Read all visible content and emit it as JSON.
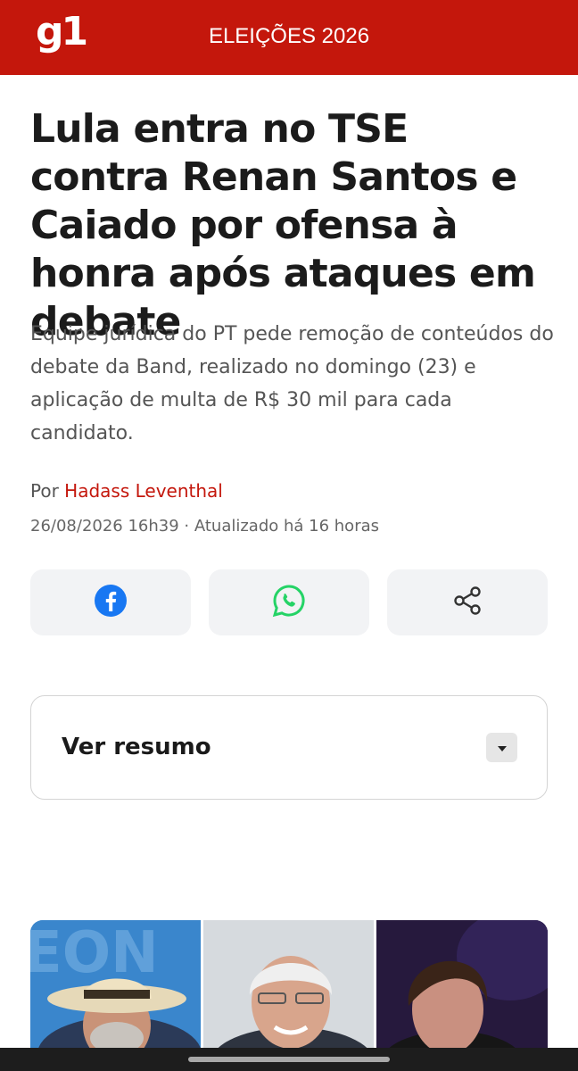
{
  "header": {
    "logo": "g1",
    "section": "ELEIÇÕES 2026",
    "brand_color": "#c4170c"
  },
  "article": {
    "headline": "Lula entra no TSE contra Renan Santos e Caiado por ofensa à honra após ataques em debate",
    "subtitle": "Equipe jurídica do PT pede remoção de conteúdos do debate da Band, realizado no domingo (23) e aplicação de multa de R$ 30 mil para cada candidato.",
    "byline_prefix": "Por",
    "author": "Hadass Leventhal",
    "dateline": "26/08/2026 16h39 · Atualizado há 16 horas"
  },
  "share": {
    "buttons": [
      {
        "icon": "facebook-icon",
        "color": "#1877f2"
      },
      {
        "icon": "whatsapp-icon",
        "color": "#25d366"
      },
      {
        "icon": "share-icon",
        "color": "#333333"
      }
    ]
  },
  "summary": {
    "label": "Ver resumo",
    "toggle_icon": "caret-down-icon"
  },
  "photos": [
    {
      "name": "lula-photo"
    },
    {
      "name": "caiado-photo"
    },
    {
      "name": "renan-santos-photo"
    }
  ]
}
